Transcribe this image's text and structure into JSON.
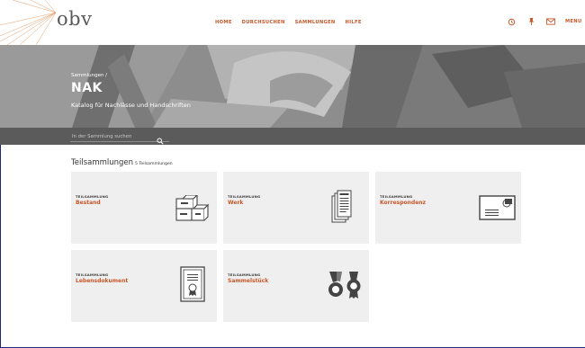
{
  "header": {
    "logo": "obv",
    "nav": [
      "HOME",
      "DURCHSUCHEN",
      "SAMMLUNGEN",
      "HILFE"
    ],
    "icons": [
      "history-icon",
      "pin-icon",
      "mail-icon"
    ],
    "menu_label": "MENU"
  },
  "hero": {
    "breadcrumb": "Sammlungen  /",
    "title": "NAK",
    "subtitle": "Katalog für Nachlässe und Handschriften"
  },
  "search": {
    "placeholder": "In der Sammlung suchen"
  },
  "section": {
    "title": "Teilsammlungen",
    "count": "5 Teilsammlungen"
  },
  "cards": [
    {
      "tag": "TEILSAMMLUNG",
      "name": "Bestand",
      "icon": "archive-boxes-icon"
    },
    {
      "tag": "TEILSAMMLUNG",
      "name": "Werk",
      "icon": "document-stack-icon"
    },
    {
      "tag": "TEILSAMMLUNG",
      "name": "Korrespondenz",
      "icon": "envelope-icon"
    },
    {
      "tag": "TEILSAMMLUNG",
      "name": "Lebensdokument",
      "icon": "certificate-icon"
    },
    {
      "tag": "TEILSAMMLUNG",
      "name": "Sammelstück",
      "icon": "medals-icon"
    }
  ],
  "colors": {
    "accent": "#c8582a",
    "card_bg": "#efefef",
    "strip": "#5b5b5b",
    "frame": "#1e2a78"
  }
}
